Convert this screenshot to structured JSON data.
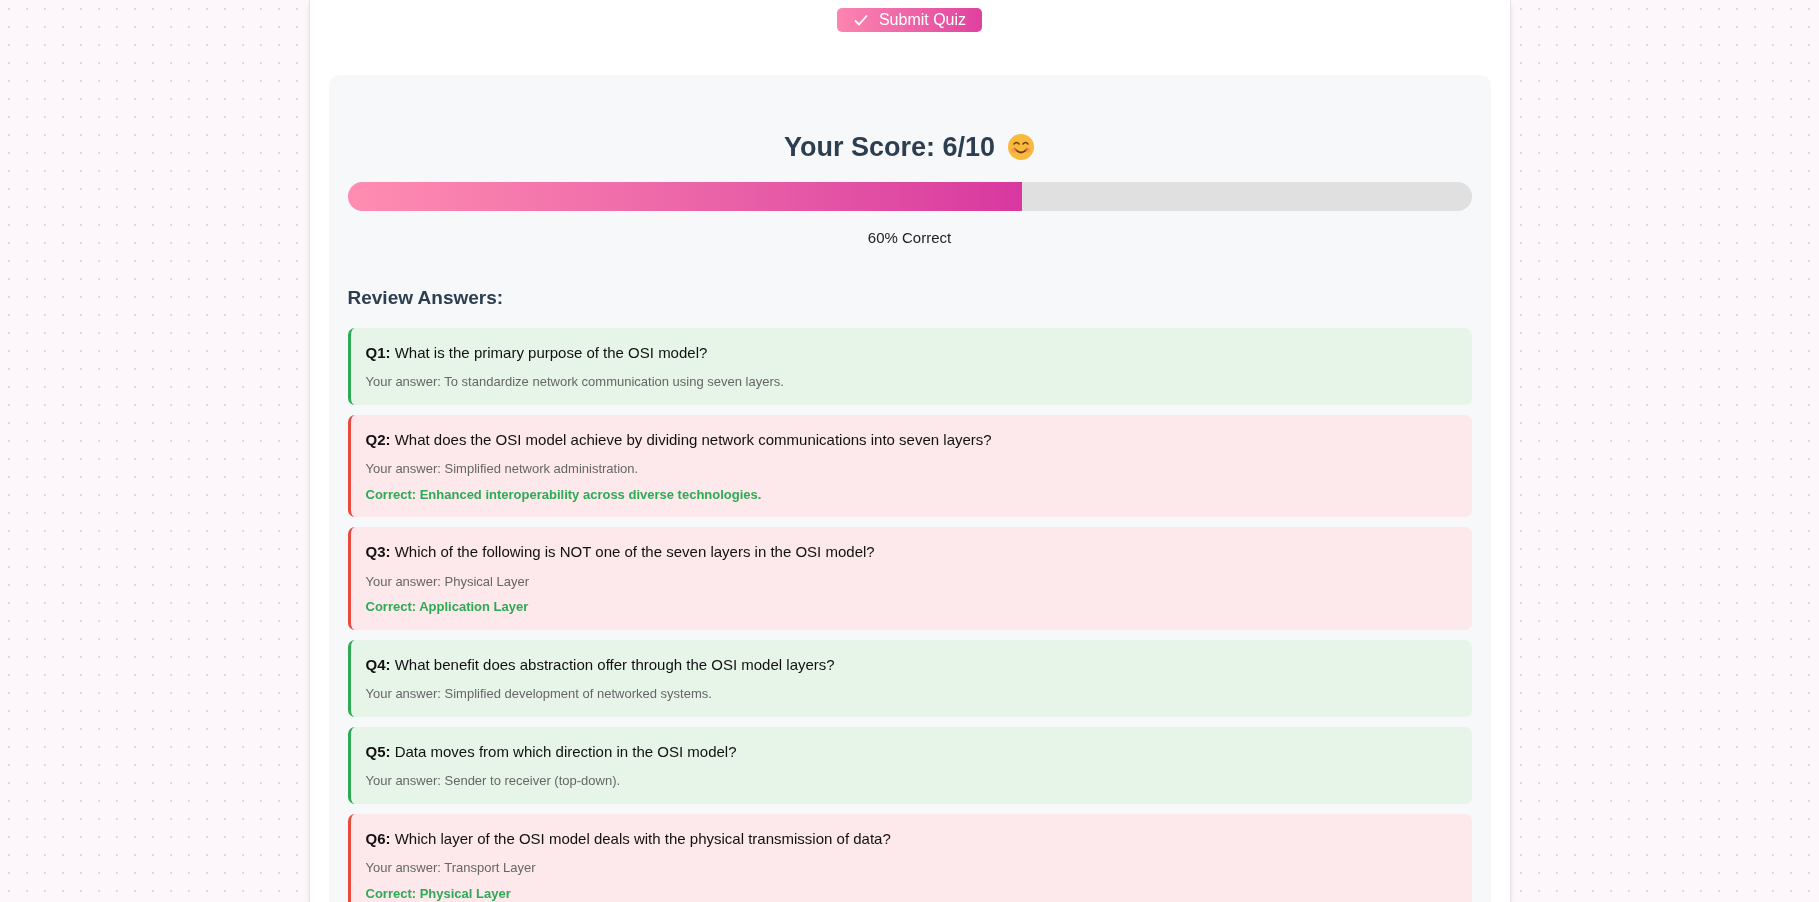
{
  "submit_button": {
    "label": "Submit Quiz"
  },
  "score": {
    "title": "Your Score: 6/10",
    "level": 0.6,
    "reading": "60% Correct"
  },
  "review": {
    "heading": "Review Answers:",
    "items": [
      {
        "question": "**Q1:** What is the primary purpose of the OSI model?",
        "answer": "Your answer: To standardize network communication using seven layers.",
        "correct": true
      },
      {
        "question": "**Q2:** What does the OSI model achieve by dividing network communications into seven layers?",
        "answer": "Your answer: Simplified network administration.",
        "correct": false,
        "correct_answer": "Correct: Enhanced interoperability across diverse technologies."
      },
      {
        "question": "**Q3:** Which of the following is NOT one of the seven layers in the OSI model?",
        "answer": "Your answer: Physical Layer",
        "correct": false,
        "correct_answer": "Correct: Application Layer"
      },
      {
        "question": "**Q4:** What benefit does abstraction offer through the OSI model layers?",
        "answer": "Your answer: Simplified development of networked systems.",
        "correct": true
      },
      {
        "question": "**Q5:** Data moves from which direction in the OSI model?",
        "answer": "Your answer: Sender to receiver (top-down).",
        "correct": true
      },
      {
        "question": "**Q6:** Which layer of the OSI model deals with the physical transmission of data?",
        "answer": "Your answer: Transport Layer",
        "correct": false,
        "correct_answer": "Correct: Physical Layer"
      }
    ]
  }
}
